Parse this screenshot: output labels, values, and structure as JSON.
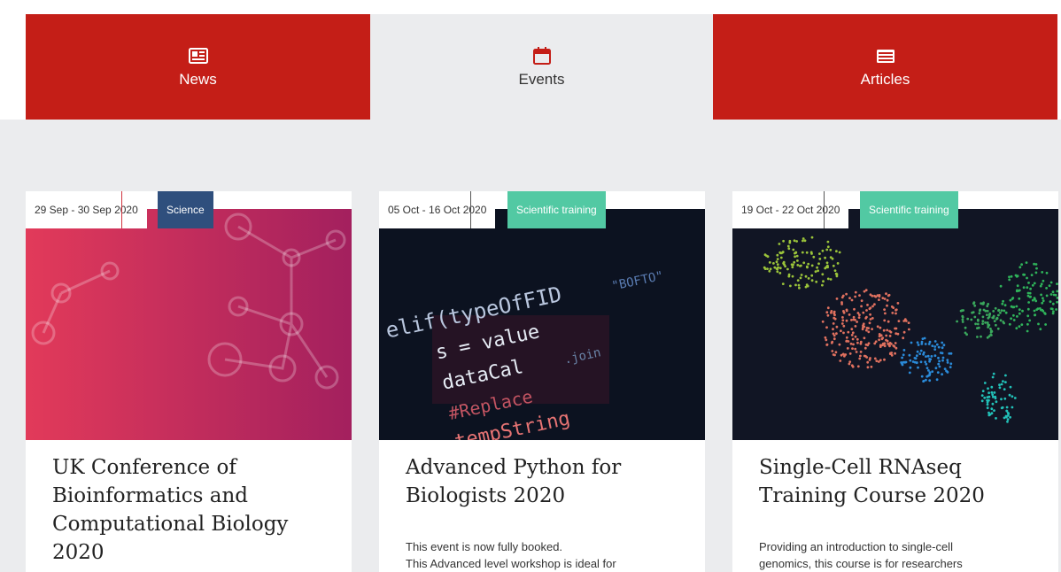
{
  "tabs": [
    {
      "label": "News",
      "icon": "newspaper-icon"
    },
    {
      "label": "Events",
      "icon": "calendar-icon"
    },
    {
      "label": "Articles",
      "icon": "list-icon"
    }
  ],
  "colors": {
    "brand_red": "#c41e17",
    "science": "#2f4f7d",
    "training": "#52c9a3",
    "background": "#ebecee"
  },
  "cards": [
    {
      "date": "29 Sep - 30 Sep 2020",
      "category": "Science",
      "title": "UK Conference of Bioinformatics and Computational Biology 2020",
      "description": []
    },
    {
      "date": "05 Oct - 16 Oct 2020",
      "category": "Scientific training",
      "title": "Advanced Python for Biologists 2020",
      "description": [
        "This event is now fully booked.",
        "This Advanced level workshop is ideal for"
      ]
    },
    {
      "date": "19 Oct - 22 Oct 2020",
      "category": "Scientific training",
      "title": "Single-Cell RNAseq Training Course 2020",
      "description": [
        "Providing an introduction to single-cell",
        "genomics, this course is for researchers"
      ]
    }
  ]
}
